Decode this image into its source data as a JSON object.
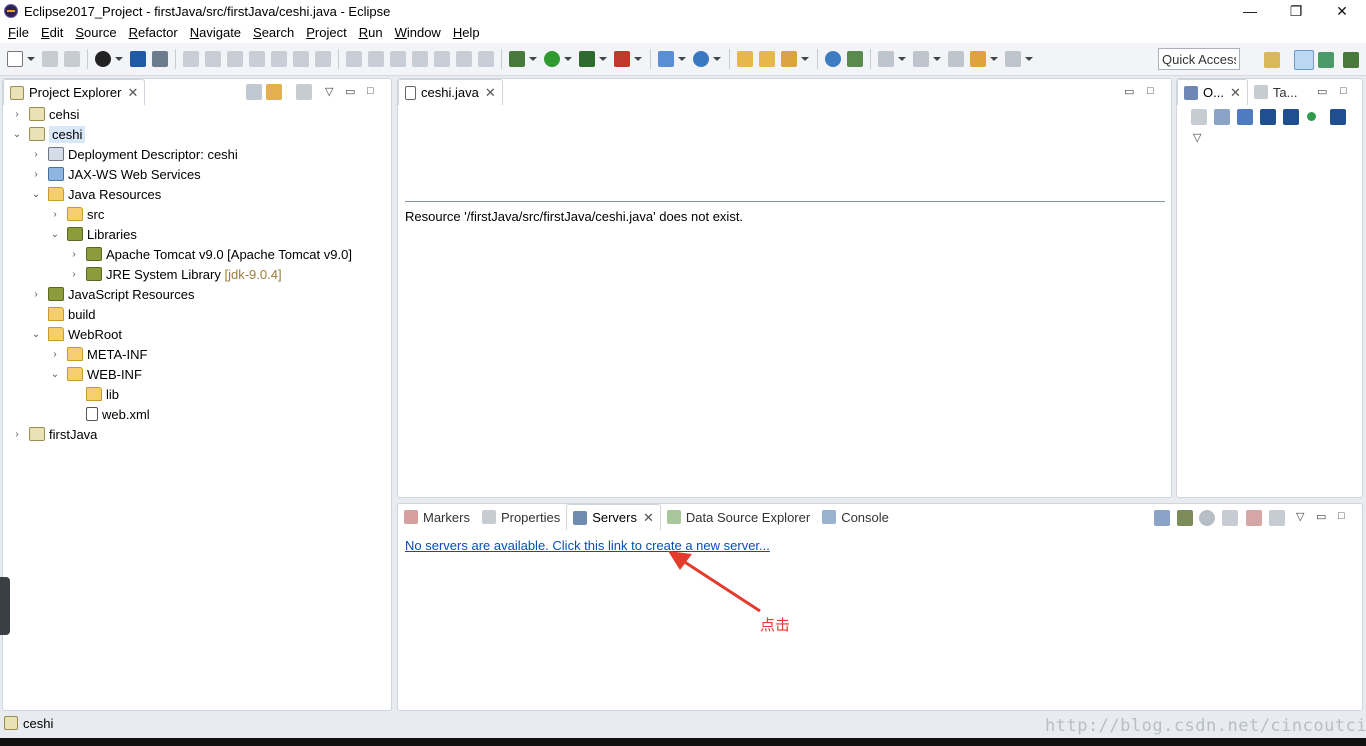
{
  "window": {
    "title": "Eclipse2017_Project - firstJava/src/firstJava/ceshi.java - Eclipse",
    "controls": [
      "—",
      "❐",
      "✕"
    ]
  },
  "menu": [
    "File",
    "Edit",
    "Source",
    "Refactor",
    "Navigate",
    "Search",
    "Project",
    "Run",
    "Window",
    "Help"
  ],
  "toolbar": {
    "quick_access": "Quick Access"
  },
  "project_explorer": {
    "tab_label": "Project Explorer",
    "tab_close": "✕",
    "items": [
      {
        "label": "cehsi",
        "twisty": "›"
      },
      {
        "label": "ceshi",
        "twisty": "⌄"
      },
      {
        "label": "Deployment Descriptor: ceshi",
        "twisty": "›"
      },
      {
        "label": "JAX-WS Web Services",
        "twisty": "›"
      },
      {
        "label": "Java Resources",
        "twisty": "⌄"
      },
      {
        "label": "src",
        "twisty": "›"
      },
      {
        "label": "Libraries",
        "twisty": "⌄"
      },
      {
        "label": "Apache Tomcat v9.0 [Apache Tomcat v9.0]",
        "twisty": "›"
      },
      {
        "label": "JRE System Library",
        "decoration": "[jdk-9.0.4]",
        "twisty": "›"
      },
      {
        "label": "JavaScript Resources",
        "twisty": "›"
      },
      {
        "label": "build",
        "twisty": ""
      },
      {
        "label": "WebRoot",
        "twisty": "⌄"
      },
      {
        "label": "META-INF",
        "twisty": "›"
      },
      {
        "label": "WEB-INF",
        "twisty": "⌄"
      },
      {
        "label": "lib",
        "twisty": ""
      },
      {
        "label": "web.xml",
        "twisty": ""
      },
      {
        "label": "firstJava",
        "twisty": "›"
      }
    ]
  },
  "editor": {
    "tab_label": "ceshi.java",
    "tab_close": "✕",
    "message": "Resource '/firstJava/src/firstJava/ceshi.java' does not exist."
  },
  "outline": {
    "tabs": [
      {
        "label": "O...",
        "close": "✕"
      },
      {
        "label": "Ta...",
        "close": ""
      }
    ]
  },
  "bottom_panel": {
    "tabs": [
      {
        "label": "Markers",
        "active": false
      },
      {
        "label": "Properties",
        "active": false
      },
      {
        "label": "Servers",
        "active": true,
        "close": "✕"
      },
      {
        "label": "Data Source Explorer",
        "active": false
      },
      {
        "label": "Console",
        "active": false
      }
    ],
    "servers_link": "No servers are available. Click this link to create a new server..."
  },
  "annotation_text": "点击",
  "status_bar": {
    "text": "ceshi"
  },
  "watermark": "http://blog.csdn.net/cincoutcin",
  "colors": {
    "link": "#0b4fa8",
    "annotation": "#e33b2c",
    "selection": "#d9e8f8",
    "panel_border": "#cfd5dc"
  }
}
